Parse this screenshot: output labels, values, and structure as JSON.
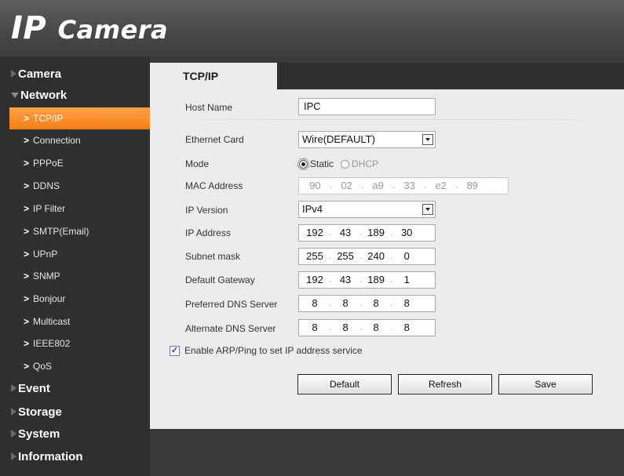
{
  "header": {
    "logo_ip": "IP",
    "logo_camera": "Camera"
  },
  "sidebar": {
    "top_items": [
      {
        "label": "Camera",
        "expanded": false
      },
      {
        "label": "Network",
        "expanded": true
      },
      {
        "label": "Event",
        "expanded": false
      },
      {
        "label": "Storage",
        "expanded": false
      },
      {
        "label": "System",
        "expanded": false
      },
      {
        "label": "Information",
        "expanded": false
      }
    ],
    "network_items": [
      {
        "label": "TCP/IP",
        "active": true
      },
      {
        "label": "Connection"
      },
      {
        "label": "PPPoE"
      },
      {
        "label": "DDNS"
      },
      {
        "label": "IP Filter"
      },
      {
        "label": "SMTP(Email)"
      },
      {
        "label": "UPnP"
      },
      {
        "label": "SNMP"
      },
      {
        "label": "Bonjour"
      },
      {
        "label": "Multicast"
      },
      {
        "label": "IEEE802"
      },
      {
        "label": "QoS"
      }
    ],
    "chevron": ">",
    "active_color": "#f57d12"
  },
  "tab": {
    "label": "TCP/IP"
  },
  "form": {
    "host_name": {
      "label": "Host Name",
      "value": "IPC"
    },
    "ethernet_card": {
      "label": "Ethernet Card",
      "value": "Wire(DEFAULT)"
    },
    "mode": {
      "label": "Mode",
      "options": [
        "Static",
        "DHCP"
      ],
      "selected": "Static"
    },
    "mac_address": {
      "label": "MAC Address",
      "octets": [
        "90",
        "02",
        "a9",
        "33",
        "e2",
        "89"
      ]
    },
    "ip_version": {
      "label": "IP Version",
      "value": "IPv4"
    },
    "ip_address": {
      "label": "IP Address",
      "octets": [
        "192",
        "43",
        "189",
        "30"
      ]
    },
    "subnet_mask": {
      "label": "Subnet mask",
      "octets": [
        "255",
        "255",
        "240",
        "0"
      ]
    },
    "default_gateway": {
      "label": "Default Gateway",
      "octets": [
        "192",
        "43",
        "189",
        "1"
      ]
    },
    "preferred_dns": {
      "label": "Preferred DNS Server",
      "octets": [
        "8",
        "8",
        "8",
        "8"
      ]
    },
    "alternate_dns": {
      "label": "Alternate DNS Server",
      "octets": [
        "8",
        "8",
        "8",
        "8"
      ]
    },
    "arp_ping": {
      "label": "Enable ARP/Ping to set IP address service",
      "checked": true
    }
  },
  "buttons": {
    "default_label": "Default",
    "refresh_label": "Refresh",
    "save_label": "Save"
  }
}
